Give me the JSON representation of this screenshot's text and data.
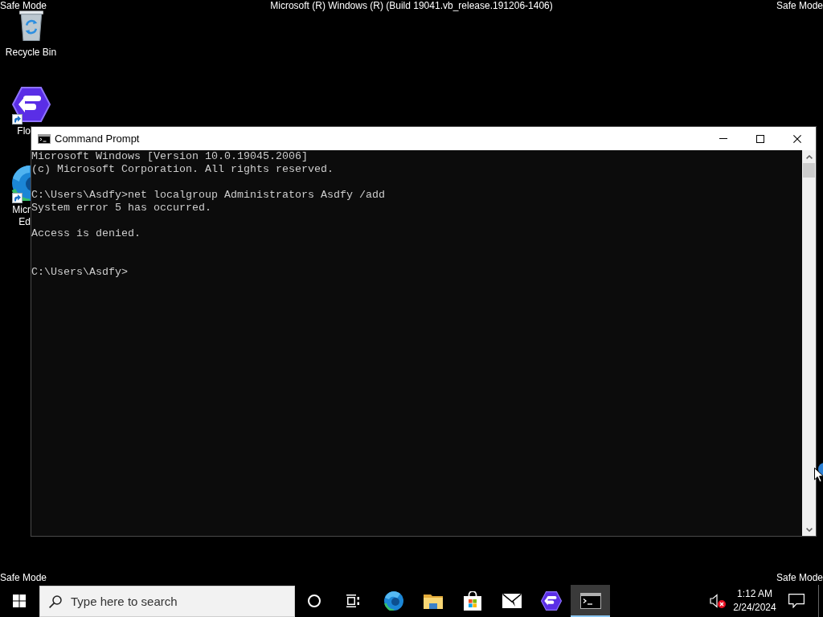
{
  "top_bar": {
    "left": "Safe Mode",
    "center": "Microsoft (R) Windows (R) (Build 19041.vb_release.191206-1406)",
    "right": "Safe Mode"
  },
  "desktop_icons": [
    {
      "kind": "bin",
      "label_lines": [
        "Recycle Bin"
      ],
      "shortcut": false
    },
    {
      "kind": "launcher",
      "label_lines": [
        "Flo"
      ],
      "shortcut": true
    },
    {
      "kind": "browser",
      "label_lines": [
        "Micr",
        "Ed"
      ],
      "shortcut": true
    }
  ],
  "window": {
    "title": "Command Prompt",
    "banner": [
      "Microsoft Windows [Version 10.0.19045.2006]",
      "(c) Microsoft Corporation. All rights reserved."
    ],
    "commands": [
      {
        "line": "C:\\Users\\Asdfy>net localgroup Administrators Asdfy /add",
        "output": [
          "System error 5 has occurred.",
          "Access is denied."
        ]
      }
    ],
    "prompt": "C:\\Users\\Asdfy>"
  },
  "bottom_bar": {
    "left": "Safe Mode",
    "right": "Safe Mode"
  },
  "taskbar": {
    "search": {
      "placeholder": "Type here to search"
    },
    "apps": [
      {
        "kind": "browser",
        "selected": false
      },
      {
        "kind": "folder",
        "selected": false
      },
      {
        "kind": "store",
        "selected": false
      },
      {
        "kind": "mail",
        "selected": false
      },
      {
        "kind": "launcher",
        "selected": false
      },
      {
        "kind": "terminal",
        "selected": true
      }
    ],
    "tray": {
      "volume_muted": true,
      "time": "1:12 AM",
      "date": "2/24/2024"
    }
  }
}
